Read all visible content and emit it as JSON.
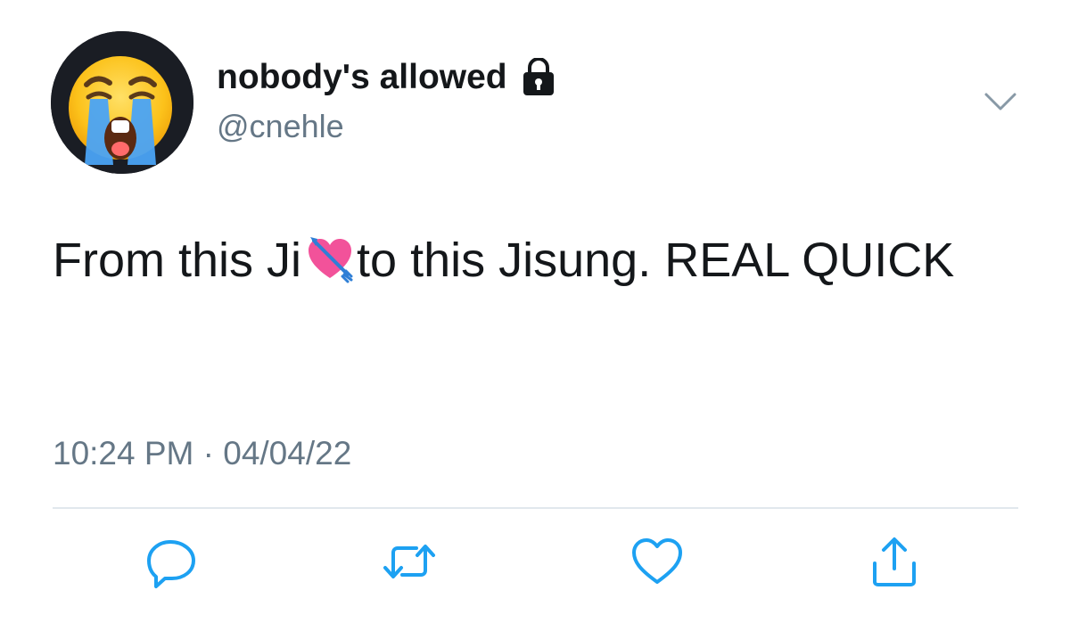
{
  "author": {
    "display_name": "nobody's allowed",
    "handle": "@cnehle",
    "avatar": "loudly-crying-face-emoji",
    "protected_icon": "lock-icon"
  },
  "tweet": {
    "text_part1": "From this Ji",
    "inline_emoji": "heart-with-arrow-emoji",
    "text_part2": "to this Jisung. REAL QUICK",
    "timestamp": "10:24 PM · 04/04/22"
  },
  "actions": [
    {
      "name": "reply",
      "icon": "reply-icon"
    },
    {
      "name": "retweet",
      "icon": "retweet-icon"
    },
    {
      "name": "like",
      "icon": "heart-icon"
    },
    {
      "name": "share",
      "icon": "share-icon"
    }
  ],
  "menu_icon": "chevron-down-icon",
  "colors": {
    "text": "#14171a",
    "secondary": "#657786",
    "divider": "#e1e8ed",
    "icon": "#1da1f2"
  }
}
